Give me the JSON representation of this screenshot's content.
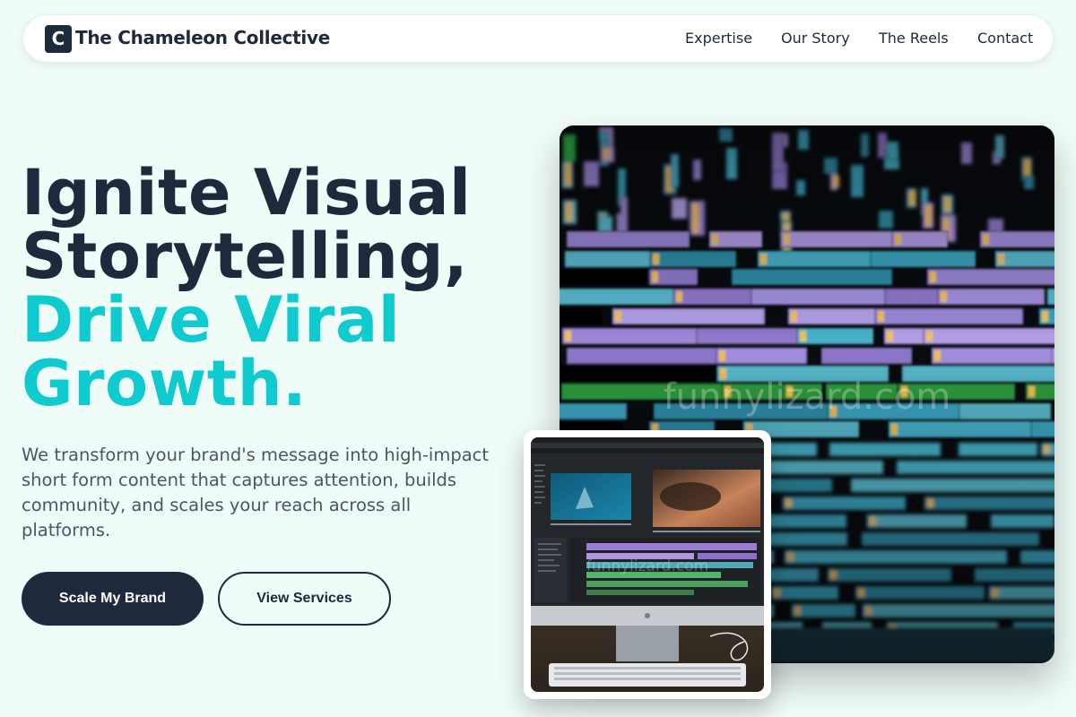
{
  "nav": {
    "logo_letter": "C",
    "brand": "The Chameleon Collective",
    "links": [
      "Expertise",
      "Our Story",
      "The Reels",
      "Contact"
    ]
  },
  "hero": {
    "headline_line1": "Ignite Visual",
    "headline_line2": "Storytelling,",
    "headline_line3": "Drive Viral",
    "headline_line4": "Growth.",
    "subtext": "We transform your brand's message into high-impact short form content that captures attention, builds community, and scales your reach across all platforms.",
    "primary_button": "Scale My Brand",
    "secondary_button": "View Services"
  },
  "images": {
    "main_watermark": "funnylizard.com",
    "inset_watermark": "funnylizard.com"
  },
  "colors": {
    "background": "#f0fcf7",
    "dark": "#1e293b",
    "accent": "#0fcbd0",
    "body_text": "#4b5563"
  }
}
